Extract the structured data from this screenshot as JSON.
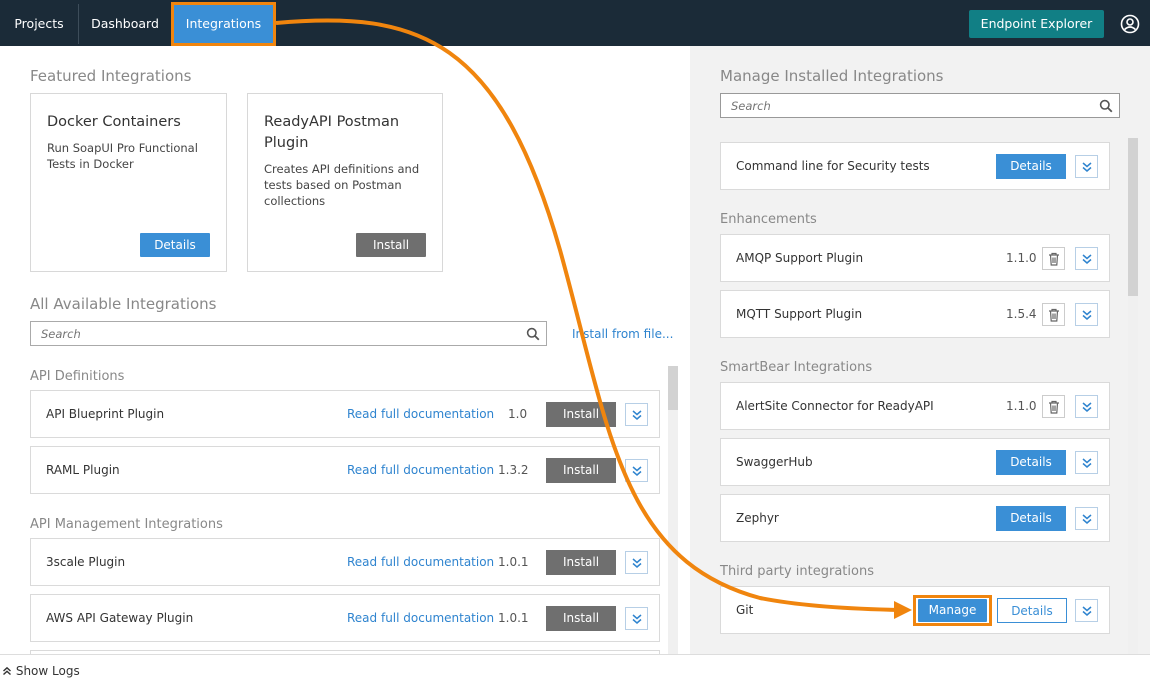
{
  "topbar": {
    "nav": [
      "Projects",
      "Dashboard",
      "Integrations"
    ],
    "active": "Integrations",
    "endpoint_explorer": "Endpoint Explorer"
  },
  "left": {
    "featured_title": "Featured Integrations",
    "featured": [
      {
        "title": "Docker Containers",
        "desc": "Run SoapUI Pro Functional Tests in Docker",
        "button": "Details"
      },
      {
        "title": "ReadyAPI Postman Plugin",
        "desc": "Creates API definitions and tests based on Postman collections",
        "button": "Install"
      }
    ],
    "available_title": "All Available Integrations",
    "search_placeholder": "Search",
    "install_from_file": "Install from file...",
    "api_definitions_title": "API Definitions",
    "api_definitions": [
      {
        "name": "API Blueprint Plugin",
        "link": "Read full documentation",
        "version": "1.0",
        "button": "Install"
      },
      {
        "name": "RAML Plugin",
        "link": "Read full documentation",
        "version": "1.3.2",
        "button": "Install"
      }
    ],
    "api_management_title": "API Management Integrations",
    "api_management": [
      {
        "name": "3scale Plugin",
        "link": "Read full documentation",
        "version": "1.0.1",
        "button": "Install"
      },
      {
        "name": "AWS API Gateway Plugin",
        "link": "Read full documentation",
        "version": "1.0.1",
        "button": "Install"
      }
    ]
  },
  "right": {
    "title": "Manage Installed Integrations",
    "search_placeholder": "Search",
    "top_item": {
      "name": "Command line for Security tests",
      "button": "Details"
    },
    "enhancements_title": "Enhancements",
    "enhancements": [
      {
        "name": "AMQP Support Plugin",
        "version": "1.1.0"
      },
      {
        "name": "MQTT Support Plugin",
        "version": "1.5.4"
      }
    ],
    "smartbear_title": "SmartBear Integrations",
    "smartbear": [
      {
        "name": "AlertSite Connector for ReadyAPI",
        "version": "1.1.0"
      },
      {
        "name": "SwaggerHub",
        "button": "Details"
      },
      {
        "name": "Zephyr",
        "button": "Details"
      }
    ],
    "third_party_title": "Third party integrations",
    "git": {
      "name": "Git",
      "manage": "Manage",
      "details": "Details"
    }
  },
  "footer": {
    "show_logs": "Show Logs"
  },
  "colors": {
    "topbar": "#1b2b38",
    "accent": "#3a8fd6",
    "highlight": "#f0850e",
    "teal": "#117f85"
  }
}
